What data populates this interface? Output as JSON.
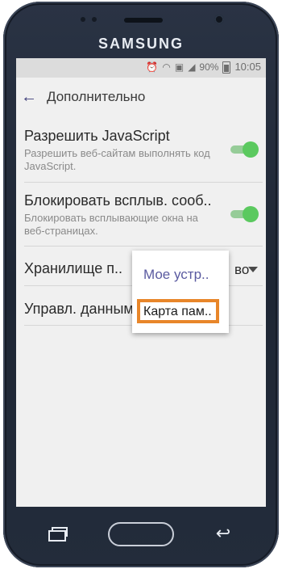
{
  "device": {
    "brand": "SAMSUNG"
  },
  "status_bar": {
    "battery": "90%",
    "time": "10:05"
  },
  "app_bar": {
    "title": "Дополнительно"
  },
  "settings": [
    {
      "title": "Разрешить JavaScript",
      "subtitle": "Разрешить веб-сайтам выполнять код JavaScript.",
      "enabled": true
    },
    {
      "title": "Блокировать всплыв. сооб..",
      "subtitle": "Блокировать всплывающие окна на веб-страницах.",
      "enabled": true
    },
    {
      "title": "Хранилище п..",
      "value": "во"
    },
    {
      "title": "Управл. данным"
    }
  ],
  "storage_popup": {
    "options": [
      "Мое устр..",
      "Карта пам.."
    ],
    "highlighted_index": 1
  },
  "colors": {
    "toggle_on": "#5bc95f",
    "highlight_border": "#e8862a",
    "popup_text": "#5a5aa0"
  }
}
